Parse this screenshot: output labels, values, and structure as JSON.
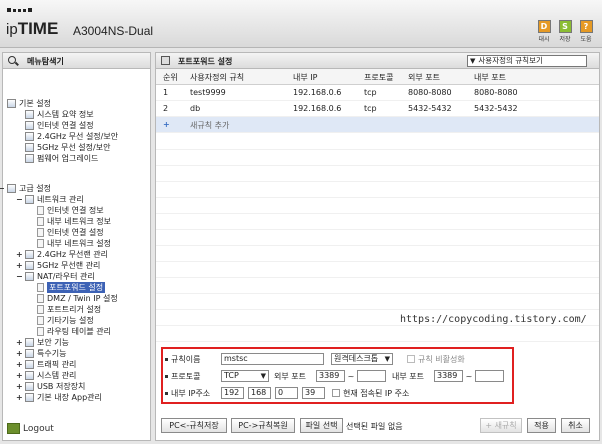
{
  "header": {
    "brand_ip": "ip",
    "brand_time": "TIME",
    "model": "A3004NS-Dual",
    "buttons": [
      {
        "label": "대시",
        "color": "#e69a25",
        "icon": "dashboard-icon",
        "glyph": "D"
      },
      {
        "label": "저장",
        "color": "#8bbd33",
        "icon": "save-icon",
        "glyph": "S"
      },
      {
        "label": "도움",
        "color": "#e69a25",
        "icon": "help-icon",
        "glyph": "?"
      }
    ]
  },
  "sidebar": {
    "title": "메뉴탐색기",
    "logout": "Logout",
    "items": [
      {
        "label": "기본 설정",
        "level": 0,
        "toggle": "",
        "icon": "folder"
      },
      {
        "label": "시스템 요약 정보",
        "level": 1,
        "toggle": "",
        "icon": "page"
      },
      {
        "label": "인터넷 연결 설정",
        "level": 1,
        "toggle": "",
        "icon": "page"
      },
      {
        "label": "2.4GHz 무선 설정/보안",
        "level": 1,
        "toggle": "",
        "icon": "page"
      },
      {
        "label": "5GHz 무선 설정/보안",
        "level": 1,
        "toggle": "",
        "icon": "page"
      },
      {
        "label": "펌웨어 업그레이드",
        "level": 1,
        "toggle": "",
        "icon": "page"
      },
      {
        "label": "고급 설정",
        "level": 0,
        "toggle": "−",
        "icon": "folder"
      },
      {
        "label": "네트워크 관리",
        "level": 1,
        "toggle": "−",
        "icon": "folder"
      },
      {
        "label": "인터넷 연결 정보",
        "level": 2,
        "toggle": "",
        "icon": "doc"
      },
      {
        "label": "내부 네트워크 정보",
        "level": 2,
        "toggle": "",
        "icon": "doc"
      },
      {
        "label": "인터넷 연결 설정",
        "level": 2,
        "toggle": "",
        "icon": "doc"
      },
      {
        "label": "내부 네트워크 설정",
        "level": 2,
        "toggle": "",
        "icon": "doc"
      },
      {
        "label": "2.4GHz 무선랜 관리",
        "level": 1,
        "toggle": "+",
        "icon": "folder"
      },
      {
        "label": "5GHz 무선랜 관리",
        "level": 1,
        "toggle": "+",
        "icon": "folder"
      },
      {
        "label": "NAT/라우터 관리",
        "level": 1,
        "toggle": "−",
        "icon": "folder"
      },
      {
        "label": "포트포워드 설정",
        "level": 2,
        "toggle": "",
        "icon": "doc",
        "selected": true
      },
      {
        "label": "DMZ / Twin IP 설정",
        "level": 2,
        "toggle": "",
        "icon": "doc"
      },
      {
        "label": "포트트리거 설정",
        "level": 2,
        "toggle": "",
        "icon": "doc"
      },
      {
        "label": "기타기능 설정",
        "level": 2,
        "toggle": "",
        "icon": "doc"
      },
      {
        "label": "라우팅 테이블 관리",
        "level": 2,
        "toggle": "",
        "icon": "doc"
      },
      {
        "label": "보안 기능",
        "level": 1,
        "toggle": "+",
        "icon": "folder"
      },
      {
        "label": "특수기능",
        "level": 1,
        "toggle": "+",
        "icon": "folder"
      },
      {
        "label": "트래픽 관리",
        "level": 1,
        "toggle": "+",
        "icon": "folder"
      },
      {
        "label": "시스템 관리",
        "level": 1,
        "toggle": "+",
        "icon": "folder"
      },
      {
        "label": "USB 저장장치",
        "level": 1,
        "toggle": "+",
        "icon": "folder"
      },
      {
        "label": "기본 내장 App관리",
        "level": 1,
        "toggle": "+",
        "icon": "folder"
      }
    ]
  },
  "main": {
    "title": "포트포워드 설정",
    "view_select": "사용자정의 규칙보기",
    "columns": [
      "순위",
      "사용자정의 규칙",
      "내부 IP",
      "프로토콜",
      "외부 포트",
      "내부 포트"
    ],
    "rows": [
      {
        "rank": "1",
        "name": "test9999",
        "ip": "192.168.0.6",
        "proto": "tcp",
        "ext": "8080-8080",
        "int": "8080-8080"
      },
      {
        "rank": "2",
        "name": "db",
        "ip": "192.168.0.6",
        "proto": "tcp",
        "ext": "5432-5432",
        "int": "5432-5432"
      }
    ],
    "add_symbol": "+",
    "add_label": "새규칙 추가",
    "watermark": "https://copycoding.tistory.com/"
  },
  "form": {
    "rule_name_label": "규칙이름",
    "rule_name_value": "mstsc",
    "rule_type_select": "원격데스크톱",
    "disable_label": "규칙 비활성화",
    "protocol_label": "프로토콜",
    "protocol_value": "TCP",
    "ext_port_label": "외부 포트",
    "ext_port_from": "3389",
    "ext_port_sep": "~",
    "ext_port_to": "",
    "int_port_label": "내부 포트",
    "int_port_from": "3389",
    "int_port_sep": "~",
    "int_port_to": "",
    "ip_label": "내부 IP주소",
    "ip_1": "192",
    "ip_2": "168",
    "ip_3": "0",
    "ip_4": "39",
    "current_ip_label": "현재 접속된 IP 주소"
  },
  "footer": {
    "pc_save": "PC<-규칙저장",
    "pc_restore": "PC->규칙복원",
    "file_select": "파일 선택",
    "no_file": "선택된 파일 없음",
    "add_rule": "+ 새규칙",
    "apply": "적용",
    "cancel": "취소"
  }
}
